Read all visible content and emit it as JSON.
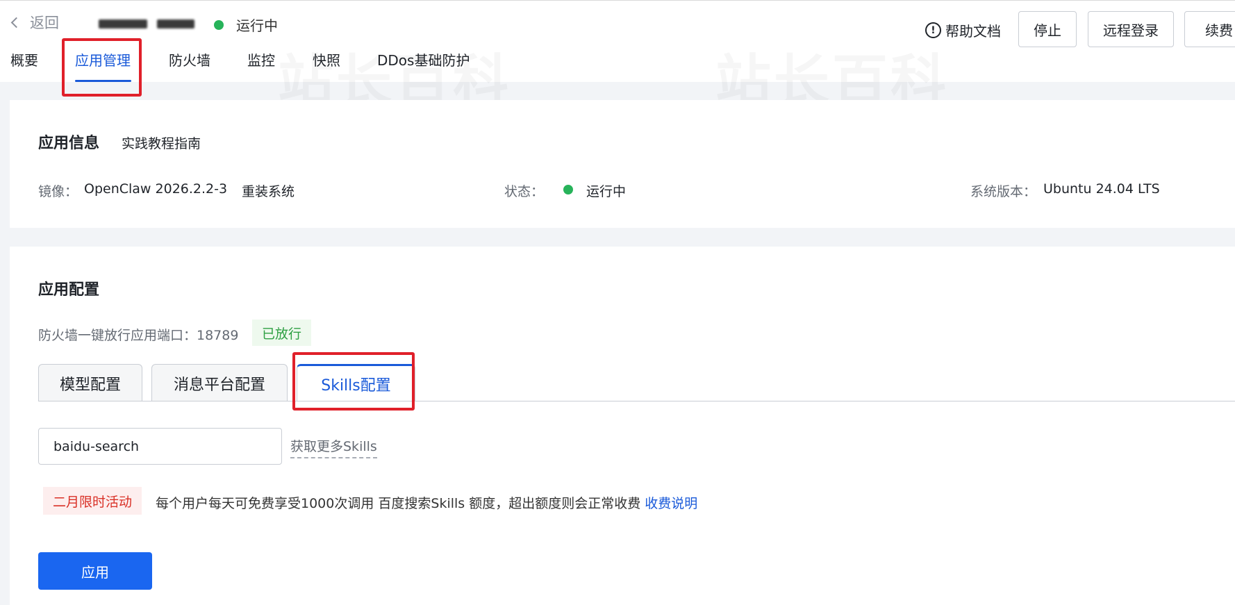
{
  "header": {
    "back_label": "返回",
    "status_text": "运行中",
    "status_color": "#27b35a",
    "help_label": "帮助文档",
    "help_icon": "exclamation-circle-icon",
    "buttons": {
      "stop": "停止",
      "remote_login": "远程登录",
      "renew": "续费"
    }
  },
  "nav": {
    "items": [
      "概要",
      "应用管理",
      "防火墙",
      "监控",
      "快照",
      "DDos基础防护"
    ],
    "active": "应用管理"
  },
  "app_info": {
    "title": "应用信息",
    "guide_link": "实践教程指南",
    "image_label": "镜像：",
    "image_value": "OpenClaw 2026.2.2-3",
    "reinstall_link": "重装系统",
    "status_label": "状态：",
    "status_value": "运行中",
    "os_label": "系统版本：",
    "os_value": "Ubuntu 24.04 LTS"
  },
  "app_config": {
    "title": "应用配置",
    "port_text": "防火墙一键放行应用端口：18789",
    "port_badge": "已放行",
    "tabs": [
      "模型配置",
      "消息平台配置",
      "Skills配置"
    ],
    "active_tab": "Skills配置",
    "skill_input_value": "baidu-search",
    "more_skills_link": "获取更多Skills",
    "promo_tag": "二月限时活动",
    "promo_text": "每个用户每天可免费享受1000次调用 百度搜索Skills 额度，超出额度则会正常收费",
    "promo_link": "收费说明",
    "apply_button": "应用"
  },
  "watermark": "站长百科",
  "colors": {
    "accent": "#1a5ad9",
    "primary_button": "#1a66f0",
    "highlight_box": "#e0202a"
  }
}
